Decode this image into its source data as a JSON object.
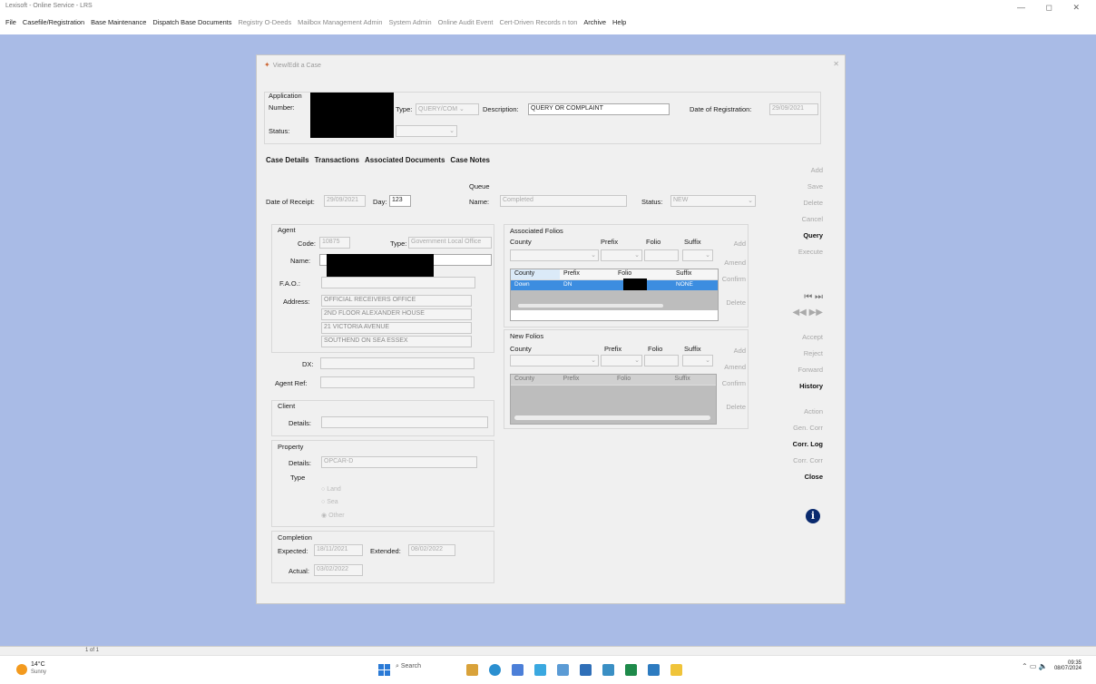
{
  "app": {
    "title": "Lexisoft - Online Service - LRS",
    "window_controls": "— ◻ ✕"
  },
  "menu": [
    {
      "label": "File",
      "dim": false
    },
    {
      "label": "Casefile/Registration",
      "dim": false
    },
    {
      "label": "Base Maintenance",
      "dim": false
    },
    {
      "label": "Dispatch Base Documents",
      "dim": false
    },
    {
      "label": "Registry O-Deeds",
      "dim": true
    },
    {
      "label": "Mailbox Management Admin",
      "dim": true
    },
    {
      "label": "System Admin",
      "dim": true
    },
    {
      "label": "Online Audit Event",
      "dim": true
    },
    {
      "label": "Cert-Driven Records n ton",
      "dim": true
    },
    {
      "label": "Archive",
      "dim": false
    },
    {
      "label": "Help",
      "dim": false
    }
  ],
  "dialog": {
    "title": "View/Edit a Case",
    "close": "✕"
  },
  "application": {
    "group_label": "Application",
    "number_label": "Number:",
    "type_label": "Type:",
    "type_value": "QUERY/COM",
    "description_label": "Description:",
    "description_value": "QUERY OR COMPLAINT",
    "registration_label": "Date of Registration:",
    "registration_value": "29/09/2021",
    "status_label": "Status:"
  },
  "tabs": [
    "Case Details",
    "Transactions",
    "Associated Documents",
    "Case Notes"
  ],
  "receipt": {
    "label": "Date of Receipt:",
    "value": "29/09/2021",
    "day_label": "Day:",
    "day_value": "123"
  },
  "queue": {
    "group_label": "Queue",
    "name_label": "Name:",
    "name_value": "Completed",
    "status_label": "Status:",
    "status_value": "NEW"
  },
  "agent": {
    "group_label": "Agent",
    "code_label": "Code:",
    "code_value": "10875",
    "type_label": "Type:",
    "type_value": "Government Local Office",
    "name_label": "Name:",
    "fao_label": "F.A.O.:",
    "address_label": "Address:",
    "address_lines": [
      "OFFICIAL RECEIVERS OFFICE",
      "2ND FLOOR ALEXANDER HOUSE",
      "21 VICTORIA AVENUE",
      "SOUTHEND ON SEA ESSEX"
    ],
    "dx_label": "DX:",
    "ref_label": "Agent Ref:"
  },
  "client": {
    "group_label": "Client",
    "details_label": "Details:"
  },
  "property": {
    "group_label": "Property",
    "details_label": "Details:",
    "details_value": "OPCAR-D",
    "type_label": "Type",
    "radios": [
      "Land",
      "Sea",
      "Other"
    ]
  },
  "completion": {
    "group_label": "Completion",
    "expected_label": "Expected:",
    "expected_value": "18/11/2021",
    "extended_label": "Extended:",
    "extended_value": "08/02/2022",
    "actual_label": "Actual:",
    "actual_value": "03/02/2022"
  },
  "assoc_folios": {
    "group_label": "Associated Folios",
    "county_label": "County",
    "prefix_label": "Prefix",
    "folio_label": "Folio",
    "suffix_label": "Suffix",
    "buttons": [
      "Add",
      "Amend",
      "Confirm",
      "Delete"
    ],
    "columns": [
      "County",
      "Prefix",
      "Folio",
      "Suffix"
    ],
    "rows": [
      [
        "Down",
        "DN",
        "",
        "NONE"
      ]
    ]
  },
  "new_folios": {
    "group_label": "New Folios",
    "county_label": "County",
    "prefix_label": "Prefix",
    "folio_label": "Folio",
    "suffix_label": "Suffix",
    "buttons": [
      "Add",
      "Amend",
      "Confirm",
      "Delete"
    ],
    "columns": [
      "County",
      "Prefix",
      "Folio",
      "Suffix"
    ]
  },
  "side_buttons": [
    {
      "label": "Add",
      "on": false
    },
    {
      "label": "Save",
      "on": false
    },
    {
      "label": "Delete",
      "on": false
    },
    {
      "label": "Cancel",
      "on": false
    },
    {
      "label": "Query",
      "on": true
    },
    {
      "label": "Execute",
      "on": false
    }
  ],
  "nav_icons": [
    "first-icon",
    "last-icon",
    "prev-icon",
    "next-icon"
  ],
  "side_buttons2": [
    {
      "label": "Accept",
      "on": false
    },
    {
      "label": "Reject",
      "on": false
    },
    {
      "label": "Forward",
      "on": false
    },
    {
      "label": "History",
      "on": true
    },
    {
      "label": "Action",
      "on": false
    },
    {
      "label": "Gen. Corr",
      "on": false
    },
    {
      "label": "Corr. Log",
      "on": true
    },
    {
      "label": "Corr. Corr",
      "on": false
    },
    {
      "label": "Close",
      "on": true
    }
  ],
  "statusbar": {
    "page": "1 of 1"
  },
  "taskbar": {
    "weather_temp": "14°C",
    "weather_desc": "Sunny",
    "search": "Search",
    "time": "09:35",
    "date": "08/07/2024"
  }
}
